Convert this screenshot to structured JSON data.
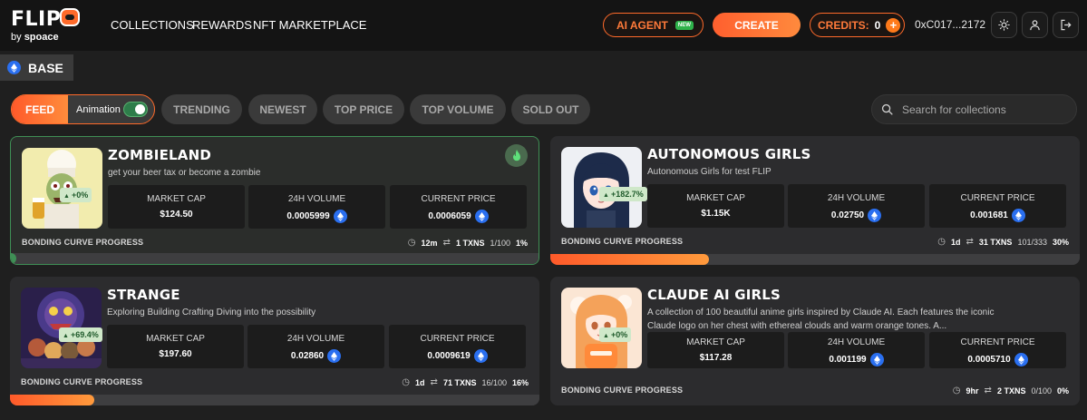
{
  "header": {
    "logo_text": "FLIP",
    "logo_by": "by",
    "logo_brand": "spoace",
    "nav": [
      "COLLECTIONS",
      "REWARDS",
      "NFT MARKETPLACE"
    ],
    "ai_agent_label": "AI AGENT",
    "new_badge": "NEW",
    "create_label": "CREATE",
    "credits_label": "CREDITS:",
    "credits_value": "0",
    "wallet": "0xC017...2172",
    "icons": [
      "sun-icon",
      "user-icon",
      "logout-icon"
    ]
  },
  "chain": {
    "label": "BASE",
    "icon": "eth-icon"
  },
  "filters": {
    "feed_label": "FEED",
    "animation_label": "Animation",
    "animation_on": true,
    "tabs": [
      "TRENDING",
      "NEWEST",
      "TOP PRICE",
      "TOP VOLUME",
      "SOLD OUT"
    ],
    "search_placeholder": "Search for collections"
  },
  "stat_labels": {
    "market_cap": "MARKET CAP",
    "volume": "24H VOLUME",
    "price": "CURRENT PRICE"
  },
  "progress_label": "BONDING CURVE PROGRESS",
  "cards": [
    {
      "name": "ZOMBIELAND",
      "description": "get your beer tax or become a zombie",
      "change": "+0%",
      "market_cap": "$124.50",
      "volume": "0.0005999",
      "price": "0.0006059",
      "age": "12m",
      "txns": "1 TXNS",
      "supply": "1/100",
      "progress_text": "1%",
      "progress": 0.01,
      "highlighted": true,
      "badge_icon": "fire-icon",
      "accent": "#3f8f55"
    },
    {
      "name": "AUTONOMOUS GIRLS",
      "description": "Autonomous Girls for test FLIP",
      "change": "+182.7%",
      "market_cap": "$1.15K",
      "volume": "0.02750",
      "price": "0.001681",
      "age": "1d",
      "txns": "31 TXNS",
      "supply": "101/333",
      "progress_text": "30%",
      "progress": 0.3
    },
    {
      "name": "STRANGE",
      "description": "Exploring Building Crafting Diving into the possibility",
      "change": "+69.4%",
      "market_cap": "$197.60",
      "volume": "0.02860",
      "price": "0.0009619",
      "age": "1d",
      "txns": "71 TXNS",
      "supply": "16/100",
      "progress_text": "16%",
      "progress": 0.16
    },
    {
      "name": "CLAUDE AI GIRLS",
      "description": "A collection of 100 beautiful anime girls inspired by Claude AI. Each features the iconic Claude logo on her chest with ethereal clouds and warm orange tones. A...",
      "change": "+0%",
      "market_cap": "$117.28",
      "volume": "0.001199",
      "price": "0.0005710",
      "age": "9hr",
      "txns": "2 TXNS",
      "supply": "0/100",
      "progress_text": "0%",
      "progress": 0.0
    }
  ],
  "colors": {
    "accent_orange": "#ff6a2a",
    "eth_blue": "#2a6ff0",
    "positive_green": "#1f5a2b",
    "background": "#1f1f1f"
  }
}
